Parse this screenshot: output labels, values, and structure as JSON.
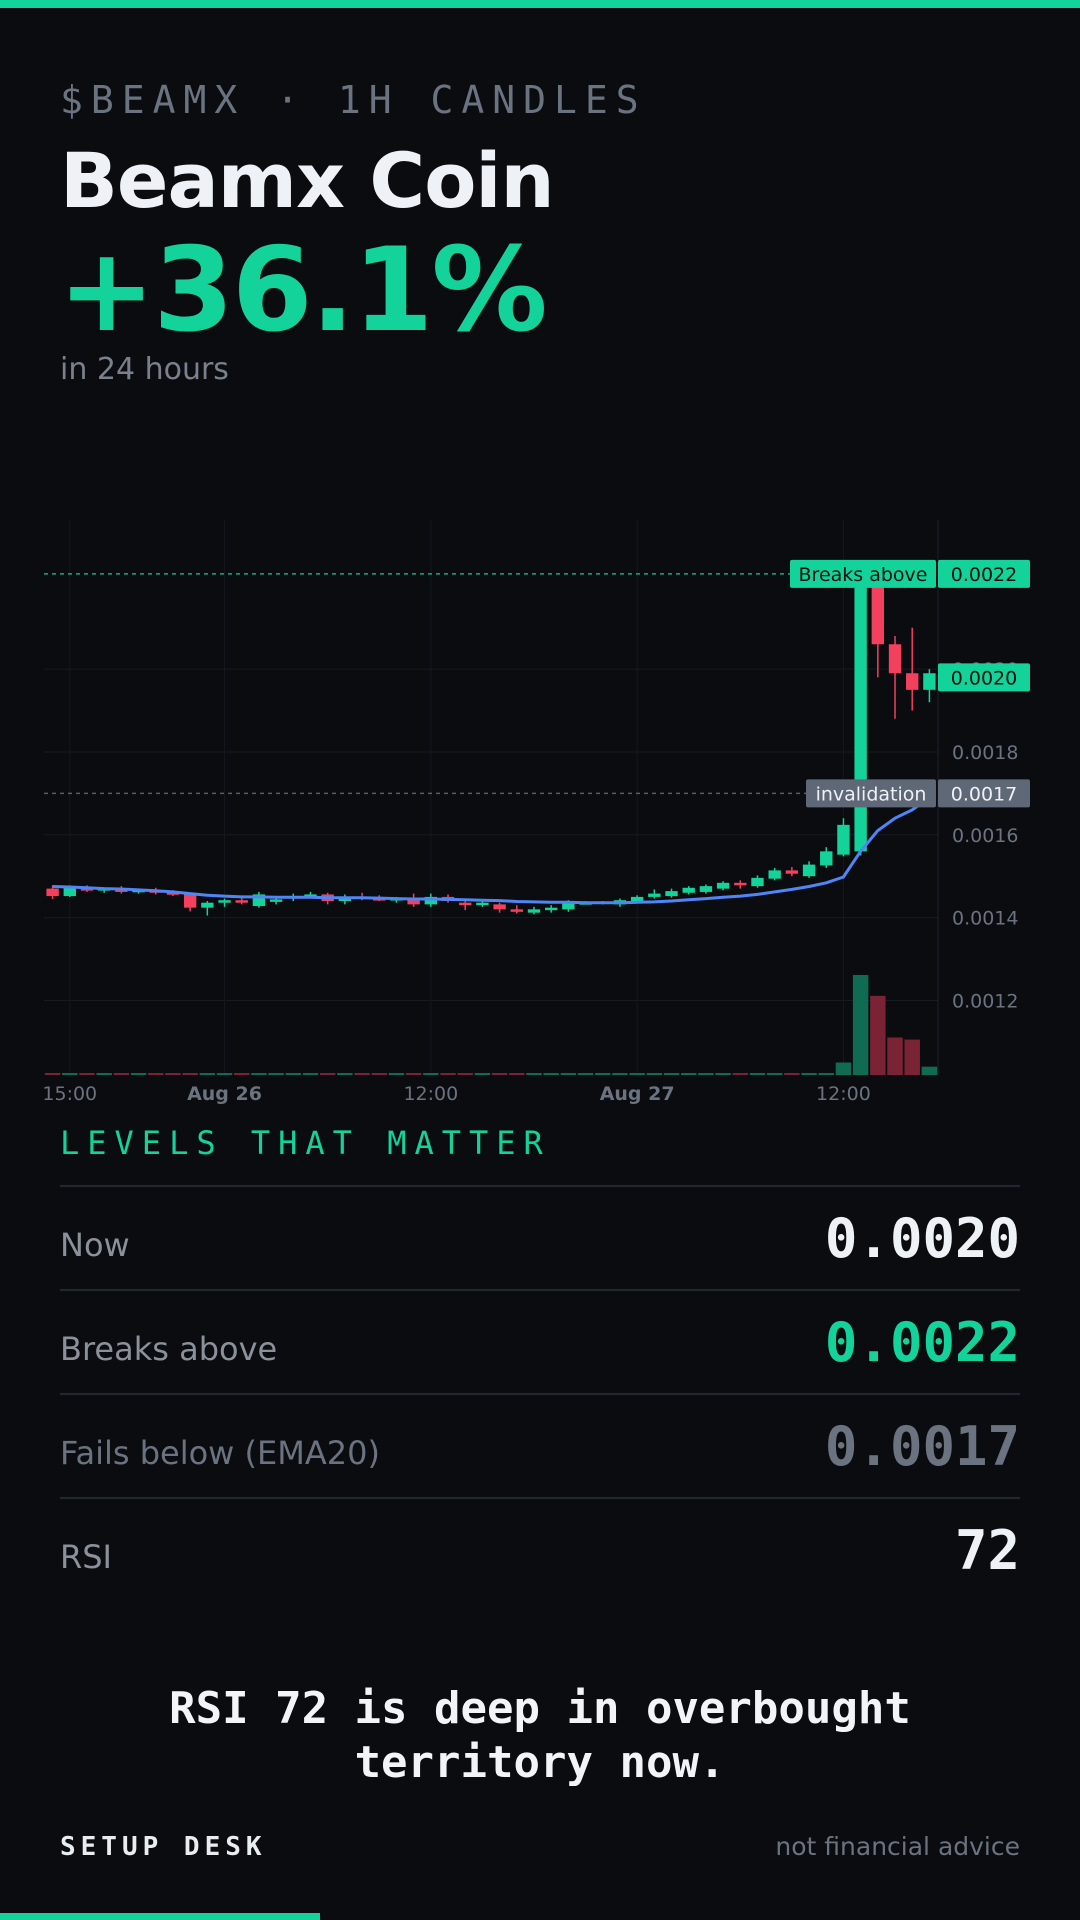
{
  "header": {
    "ticker": "$BEAMX · 1H CANDLES",
    "title": "Beamx Coin",
    "change": "+36.1%",
    "period": "in 24 hours"
  },
  "levels": {
    "heading": "LEVELS THAT MATTER",
    "rows": [
      {
        "label": "Now",
        "value": "0.0020"
      },
      {
        "label": "Breaks above",
        "value": "0.0022"
      },
      {
        "label": "Fails below (EMA20)",
        "value": "0.0017"
      },
      {
        "label": "RSI",
        "value": "72"
      }
    ]
  },
  "note": {
    "line1": "RSI 72 is deep in overbought",
    "line2": "territory now."
  },
  "footer": {
    "brand": "SETUP DESK",
    "disclaimer": "not financial advice"
  },
  "colors": {
    "up": "#14d39a",
    "down": "#f2405d",
    "ema": "#4f86f7",
    "background": "#0a0c10",
    "muted": "#6b7380"
  },
  "chart_data": {
    "type": "candlestick",
    "interval": "1H",
    "x_ticks": [
      {
        "label": "15:00",
        "index": 1,
        "bold": false
      },
      {
        "label": "Aug 26",
        "index": 10,
        "bold": true
      },
      {
        "label": "12:00",
        "index": 22,
        "bold": false
      },
      {
        "label": "Aug 27",
        "index": 34,
        "bold": true
      },
      {
        "label": "12:00",
        "index": 46,
        "bold": false
      }
    ],
    "y_ticks": [
      "0.0012",
      "0.0014",
      "0.0016",
      "0.0018",
      "0.0020"
    ],
    "y_tick_values": [
      0.0012,
      0.0014,
      0.0016,
      0.0018,
      0.002
    ],
    "ylim": [
      0.00102,
      0.00236
    ],
    "grid": true,
    "levels": [
      {
        "label": "Breaks above",
        "value_text": "0.0022",
        "value": 0.00223,
        "style": "up"
      },
      {
        "label": "invalidation",
        "value_text": "0.0017",
        "value": 0.0017,
        "style": "muted"
      }
    ],
    "last_price": {
      "value_text": "0.0020",
      "value": 0.00198
    },
    "candles": [
      [
        0.00147,
        0.001478,
        0.001445,
        0.001452
      ],
      [
        0.001452,
        0.001478,
        0.00145,
        0.001472
      ],
      [
        0.00147,
        0.001478,
        0.001462,
        0.001466
      ],
      [
        0.001466,
        0.001473,
        0.00146,
        0.00147
      ],
      [
        0.00147,
        0.001476,
        0.001458,
        0.001462
      ],
      [
        0.001462,
        0.00147,
        0.001458,
        0.001466
      ],
      [
        0.001466,
        0.001472,
        0.001456,
        0.00146
      ],
      [
        0.00146,
        0.001466,
        0.001452,
        0.001456
      ],
      [
        0.001456,
        0.00146,
        0.001415,
        0.001424
      ],
      [
        0.001424,
        0.00144,
        0.001405,
        0.001436
      ],
      [
        0.001436,
        0.001446,
        0.001426,
        0.001442
      ],
      [
        0.001442,
        0.001452,
        0.001432,
        0.001436
      ],
      [
        0.001428,
        0.001462,
        0.001424,
        0.001456
      ],
      [
        0.001438,
        0.001452,
        0.001432,
        0.001444
      ],
      [
        0.001446,
        0.001458,
        0.00144,
        0.001452
      ],
      [
        0.001452,
        0.001462,
        0.001448,
        0.001456
      ],
      [
        0.001456,
        0.00146,
        0.001432,
        0.00144
      ],
      [
        0.00144,
        0.001456,
        0.001432,
        0.001448
      ],
      [
        0.00145,
        0.00146,
        0.001442,
        0.001446
      ],
      [
        0.001446,
        0.001454,
        0.00144,
        0.001442
      ],
      [
        0.001442,
        0.00145,
        0.001436,
        0.001446
      ],
      [
        0.001446,
        0.001458,
        0.001426,
        0.001432
      ],
      [
        0.001432,
        0.001458,
        0.001426,
        0.00145
      ],
      [
        0.00145,
        0.001456,
        0.001436,
        0.00144
      ],
      [
        0.001436,
        0.001446,
        0.001418,
        0.00143
      ],
      [
        0.00143,
        0.00144,
        0.001426,
        0.001436
      ],
      [
        0.001432,
        0.001436,
        0.001412,
        0.00142
      ],
      [
        0.00142,
        0.00143,
        0.00141,
        0.001414
      ],
      [
        0.001412,
        0.001426,
        0.001408,
        0.00142
      ],
      [
        0.001418,
        0.00143,
        0.001412,
        0.001424
      ],
      [
        0.00142,
        0.001442,
        0.001414,
        0.001436
      ],
      [
        0.001436,
        0.00144,
        0.001432,
        0.001436
      ],
      [
        0.001436,
        0.00144,
        0.001432,
        0.001438
      ],
      [
        0.001432,
        0.001446,
        0.001426,
        0.001442
      ],
      [
        0.00144,
        0.001454,
        0.001436,
        0.00145
      ],
      [
        0.00145,
        0.001468,
        0.001446,
        0.001458
      ],
      [
        0.001452,
        0.00147,
        0.001448,
        0.001464
      ],
      [
        0.00146,
        0.001476,
        0.001456,
        0.001472
      ],
      [
        0.001462,
        0.00148,
        0.001458,
        0.001476
      ],
      [
        0.00147,
        0.001488,
        0.001466,
        0.001484
      ],
      [
        0.001484,
        0.00149,
        0.00147,
        0.001478
      ],
      [
        0.001476,
        0.001502,
        0.001472,
        0.001496
      ],
      [
        0.001494,
        0.00152,
        0.00149,
        0.001514
      ],
      [
        0.001514,
        0.001522,
        0.0015,
        0.001506
      ],
      [
        0.0015,
        0.001536,
        0.001496,
        0.001528
      ],
      [
        0.001526,
        0.00157,
        0.00152,
        0.00156
      ],
      [
        0.001552,
        0.00164,
        0.001548,
        0.001624
      ],
      [
        0.00156,
        0.00224,
        0.00155,
        0.0022
      ],
      [
        0.0022,
        0.00222,
        0.00198,
        0.00206
      ],
      [
        0.00206,
        0.00208,
        0.00188,
        0.00199
      ],
      [
        0.00199,
        0.0021,
        0.0019,
        0.00195
      ],
      [
        0.00195,
        0.002,
        0.00192,
        0.00199
      ]
    ],
    "volume": [
      2,
      1,
      1,
      1,
      1,
      1,
      1,
      2,
      1,
      1,
      1,
      1,
      1,
      1,
      1,
      1,
      1,
      1,
      1,
      2,
      1,
      1,
      1,
      1,
      1,
      1,
      1,
      1,
      2,
      1,
      1,
      1,
      1,
      1,
      1,
      1,
      1,
      2,
      1,
      2,
      2,
      1,
      2,
      1,
      1,
      2,
      30,
      240,
      190,
      90,
      85,
      20
    ],
    "ema20": [
      0.001475,
      0.001474,
      0.001472,
      0.00147,
      0.001469,
      0.001467,
      0.001465,
      0.001462,
      0.001458,
      0.001454,
      0.001452,
      0.00145,
      0.00145,
      0.001449,
      0.001449,
      0.001449,
      0.001448,
      0.001448,
      0.001448,
      0.001447,
      0.001446,
      0.001445,
      0.001445,
      0.001444,
      0.001443,
      0.001442,
      0.001441,
      0.001439,
      0.001438,
      0.001437,
      0.001437,
      0.001436,
      0.001436,
      0.001436,
      0.001437,
      0.001438,
      0.00144,
      0.001443,
      0.001446,
      0.001449,
      0.001452,
      0.001456,
      0.001462,
      0.001468,
      0.001475,
      0.001484,
      0.001498,
      0.00156,
      0.00161,
      0.00164,
      0.00166,
      0.00169
    ]
  }
}
